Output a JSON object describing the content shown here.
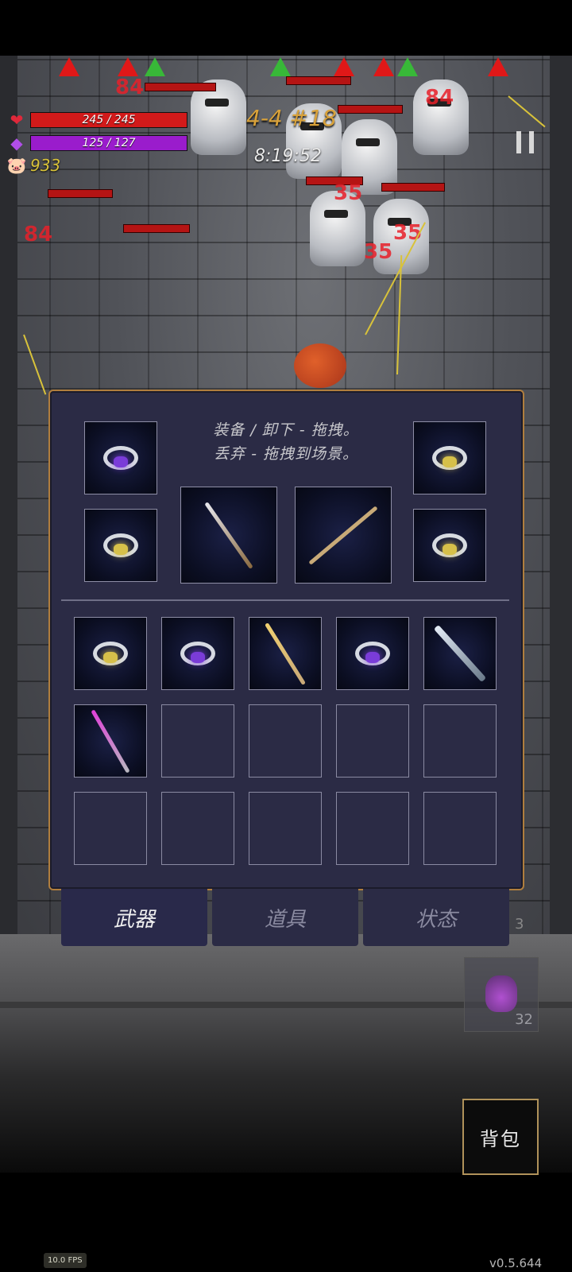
{
  "hud": {
    "hp_text": "245 / 245",
    "mp_text": "125 / 127",
    "gold": "933",
    "stage": "4-4 #18",
    "timer": "8:19:52"
  },
  "inventory": {
    "hint_line1": "装备 / 卸下 - 拖拽。",
    "hint_line2": "丢弃 - 拖拽到场景。",
    "equipped": [
      {
        "slot": "ring-top-left",
        "item": "purple-swirl-ring-icon"
      },
      {
        "slot": "ring-bottom-left",
        "item": "yellow-gem-ring-icon"
      },
      {
        "slot": "main-weapon",
        "item": "silver-spear-icon"
      },
      {
        "slot": "off-weapon",
        "item": "wooden-bow-icon"
      },
      {
        "slot": "ring-top-right",
        "item": "yellow-gem-ring-icon"
      },
      {
        "slot": "ring-bottom-right",
        "item": "yellow-gem-ring-icon"
      }
    ],
    "bag_items": [
      "yellow-gem-ring-icon",
      "purple-gem-ring-icon",
      "golden-staff-icon",
      "purple-gem-ring-icon",
      "steel-sword-icon",
      "crystal-scepter-icon"
    ]
  },
  "tabs": [
    {
      "label": "武器",
      "active": true
    },
    {
      "label": "道具",
      "active": false
    },
    {
      "label": "状态",
      "active": false
    }
  ],
  "quickbar": {
    "potion_count": "32",
    "other_count": "3"
  },
  "bag_button_label": "背包",
  "fps_text": "10.0 FPS",
  "version": "v0.5.644",
  "colors": {
    "hp": "#d21a1a",
    "mp": "#9a1ccc",
    "panel": "#2b2b45",
    "panel_border": "#b07e3e"
  }
}
